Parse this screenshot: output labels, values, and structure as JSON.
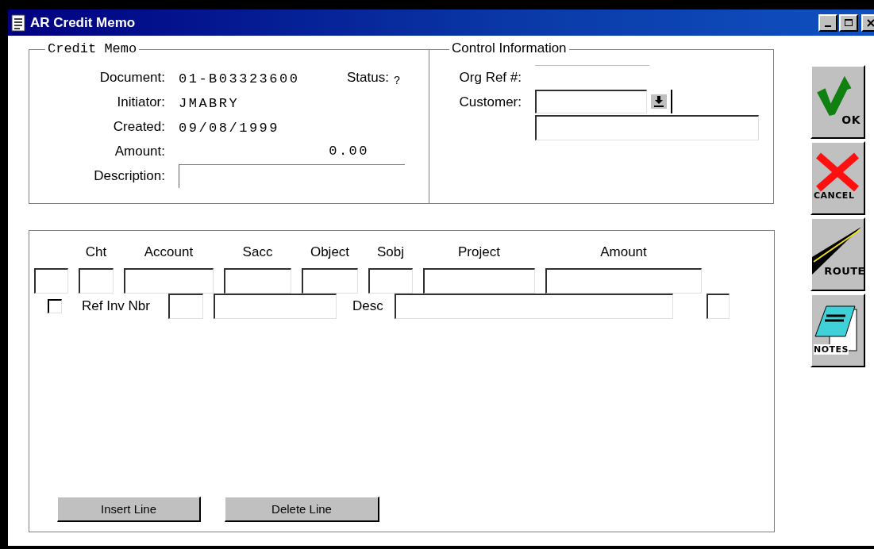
{
  "window": {
    "title": "AR Credit Memo"
  },
  "credit_memo": {
    "title": "Credit Memo",
    "fields": [
      {
        "label": "Document:",
        "kind": "text",
        "value": "01-B03323600",
        "status": {
          "label": "Status:",
          "value": "?"
        }
      },
      {
        "label": "Initiator:",
        "kind": "text",
        "value": "JMABRY"
      },
      {
        "label": "Created:",
        "kind": "text",
        "value": "09/08/1999"
      },
      {
        "label": "Amount:",
        "kind": "amount",
        "value": "0.00"
      },
      {
        "label": "Description:",
        "kind": "input"
      }
    ]
  },
  "control_information": {
    "title": "Control Information",
    "fields": [
      {
        "label": "Org Ref #:",
        "kind": "flat"
      },
      {
        "label": "Customer:",
        "kind": "dropdown"
      },
      {
        "kind": "wide"
      }
    ]
  },
  "toolbar": [
    {
      "label": "OK",
      "kind": "ok"
    },
    {
      "label": "CANCEL",
      "kind": "cancel"
    },
    {
      "label": "ROUTE",
      "kind": "route"
    },
    {
      "label": "NOTES",
      "kind": "notes"
    }
  ],
  "lines": {
    "columns": [
      "Cht",
      "Account",
      "Sacc",
      "Object",
      "Sobj",
      "Project",
      "Amount"
    ],
    "ref_row": {
      "checked": false,
      "ref_label": "Ref Inv Nbr",
      "desc_label": "Desc"
    },
    "buttons": [
      "Insert Line",
      "Delete Line"
    ]
  }
}
